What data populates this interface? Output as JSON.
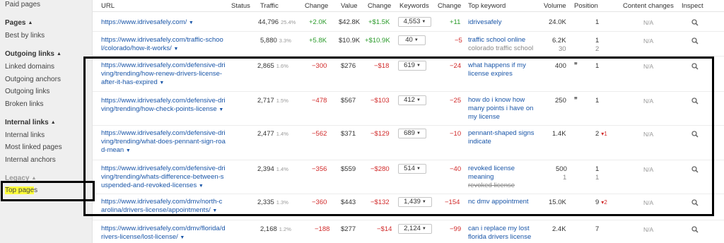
{
  "sidebar": {
    "paid_pages": "Paid pages",
    "pages_heading": "Pages",
    "best_by_links": "Best by links",
    "outgoing_heading": "Outgoing links",
    "linked_domains": "Linked domains",
    "outgoing_anchors": "Outgoing anchors",
    "outgoing_links": "Outgoing links",
    "broken_links": "Broken links",
    "internal_heading": "Internal links",
    "internal_links": "Internal links",
    "most_linked_pages": "Most linked pages",
    "internal_anchors": "Internal anchors",
    "legacy_heading": "Legacy",
    "top_pages_hl": "Top page",
    "top_pages_rest": "s"
  },
  "headers": {
    "url": "URL",
    "status": "Status",
    "traffic": "Traffic",
    "change1": "Change",
    "value": "Value",
    "change2": "Change",
    "keywords": "Keywords",
    "change3": "Change",
    "top_keyword": "Top keyword",
    "volume": "Volume",
    "position": "Position",
    "content_changes": "Content changes",
    "inspect": "Inspect"
  },
  "rows": [
    {
      "url": "https://www.idrivesafely.com/",
      "traffic": "44,796",
      "traffic_pct": "25.4%",
      "change1": "+2.0K",
      "value": "$42.8K",
      "change2": "+$1.5K",
      "keywords": "4,553",
      "change3": "+11",
      "top_keyword": "idrivesafely",
      "top_keyword_2": "",
      "volume": "24.0K",
      "volume_2": "",
      "position": "1",
      "position_2": "",
      "pos_change": "",
      "content": "N/A"
    },
    {
      "url": "https://www.idrivesafely.com/traffic-school/colorado/how-it-works/",
      "traffic": "5,880",
      "traffic_pct": "3.3%",
      "change1": "+5.8K",
      "value": "$10.9K",
      "change2": "+$10.9K",
      "keywords": "40",
      "change3": "−5",
      "top_keyword": "traffic school online",
      "top_keyword_2": "colorado traffic school",
      "volume": "6.2K",
      "volume_2": "30",
      "position": "1",
      "position_2": "2",
      "pos_change": "",
      "content": "N/A"
    },
    {
      "url": "https://www.idrivesafely.com/defensive-driving/trending/how-renew-drivers-license-after-it-has-expired",
      "traffic": "2,865",
      "traffic_pct": "1.6%",
      "change1": "−300",
      "value": "$276",
      "change2": "−$18",
      "keywords": "619",
      "change3": "−24",
      "top_keyword": "what happens if my license expires",
      "top_keyword_2": "",
      "volume": "400",
      "volume_2": "",
      "position": "1",
      "position_2": "",
      "pos_change": "",
      "content": "N/A"
    },
    {
      "url": "https://www.idrivesafely.com/defensive-driving/trending/how-check-points-license",
      "traffic": "2,717",
      "traffic_pct": "1.5%",
      "change1": "−478",
      "value": "$567",
      "change2": "−$103",
      "keywords": "412",
      "change3": "−25",
      "top_keyword": "how do i know how many points i have on my license",
      "top_keyword_2": "",
      "volume": "250",
      "volume_2": "",
      "position": "1",
      "position_2": "",
      "pos_change": "",
      "content": "N/A"
    },
    {
      "url": "https://www.idrivesafely.com/defensive-driving/trending/what-does-pennant-sign-road-mean",
      "traffic": "2,477",
      "traffic_pct": "1.4%",
      "change1": "−562",
      "value": "$371",
      "change2": "−$129",
      "keywords": "689",
      "change3": "−10",
      "top_keyword": "pennant-shaped signs indicate",
      "top_keyword_2": "",
      "volume": "1.4K",
      "volume_2": "",
      "position": "2",
      "position_2": "",
      "pos_change": "1",
      "content": "N/A"
    },
    {
      "url": "https://www.idrivesafely.com/defensive-driving/trending/whats-difference-between-suspended-and-revoked-licenses",
      "traffic": "2,394",
      "traffic_pct": "1.4%",
      "change1": "−356",
      "value": "$559",
      "change2": "−$280",
      "keywords": "514",
      "change3": "−40",
      "top_keyword": "revoked license meaning",
      "top_keyword_2": "revoked license",
      "volume": "500",
      "volume_2": "1",
      "position": "1",
      "position_2": "1",
      "pos_change": "",
      "content": "N/A"
    },
    {
      "url": "https://www.idrivesafely.com/dmv/north-carolina/drivers-license/appointments/",
      "traffic": "2,335",
      "traffic_pct": "1.3%",
      "change1": "−360",
      "value": "$443",
      "change2": "−$132",
      "keywords": "1,439",
      "change3": "−154",
      "top_keyword": "nc dmv appointment",
      "top_keyword_2": "",
      "volume": "15.0K",
      "volume_2": "",
      "position": "9",
      "position_2": "",
      "pos_change": "2",
      "content": "N/A"
    },
    {
      "url": "https://www.idrivesafely.com/dmv/florida/drivers-license/lost-license/",
      "traffic": "2,168",
      "traffic_pct": "1.2%",
      "change1": "−188",
      "value": "$277",
      "change2": "−$14",
      "keywords": "2,124",
      "change3": "−99",
      "top_keyword": "can i replace my lost florida drivers license",
      "top_keyword_2": "",
      "volume": "2.4K",
      "volume_2": "",
      "position": "7",
      "position_2": "",
      "pos_change": "",
      "content": "N/A"
    }
  ],
  "icons": {
    "dropdown": "caret-down",
    "inspect": "search-icon",
    "serp_feature": "quote-icon"
  },
  "colors": {
    "link": "#1a56a8",
    "positive": "#2a9a2a",
    "negative": "#d12a2a",
    "highlight": "#ffff3a"
  }
}
